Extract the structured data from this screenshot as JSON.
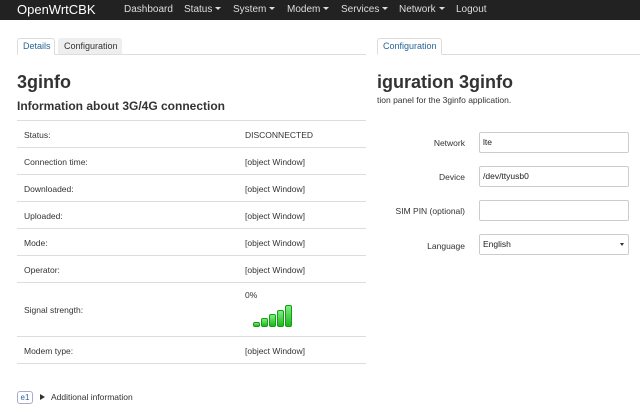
{
  "navbar": {
    "brand": "OpenWrtCBK",
    "items": [
      {
        "label": "Dashboard",
        "dropdown": false
      },
      {
        "label": "Status",
        "dropdown": true
      },
      {
        "label": "System",
        "dropdown": true
      },
      {
        "label": "Modem",
        "dropdown": true
      },
      {
        "label": "Services",
        "dropdown": true
      },
      {
        "label": "Network",
        "dropdown": true
      },
      {
        "label": "Logout",
        "dropdown": false
      }
    ]
  },
  "left": {
    "tabs": [
      {
        "label": "Details",
        "active": true
      },
      {
        "label": "Configuration",
        "active": false
      }
    ],
    "title": "3ginfo",
    "subtitle": "Information about 3G/4G connection",
    "rows": [
      {
        "label": "Status:",
        "value": "DISCONNECTED"
      },
      {
        "label": "Connection time:",
        "value": "[object Window]"
      },
      {
        "label": "Downloaded:",
        "value": "[object Window]"
      },
      {
        "label": "Uploaded:",
        "value": "[object Window]"
      },
      {
        "label": "Mode:",
        "value": "[object Window]"
      },
      {
        "label": "Operator:",
        "value": "[object Window]"
      },
      {
        "label": "Signal strength:",
        "value": "0%"
      },
      {
        "label": "Modem type:",
        "value": "[object Window]"
      }
    ],
    "signal_bars": 5,
    "badge": "e1",
    "disclosure_label": "Additional information"
  },
  "right": {
    "tabs": [
      {
        "label": "Configuration",
        "active": true
      }
    ],
    "title": "iguration 3ginfo",
    "description": "tion panel for the 3ginfo application.",
    "fields": {
      "network": {
        "label": "Network",
        "value": "lte"
      },
      "device": {
        "label": "Device",
        "value": "/dev/ttyusb0"
      },
      "sim_pin": {
        "label": "SIM PIN (optional)",
        "value": ""
      },
      "language": {
        "label": "Language",
        "value": "English"
      }
    }
  },
  "colors": {
    "navbar_bg": "#222222",
    "link": "#2a6496",
    "signal_green": "#1cb61c"
  }
}
